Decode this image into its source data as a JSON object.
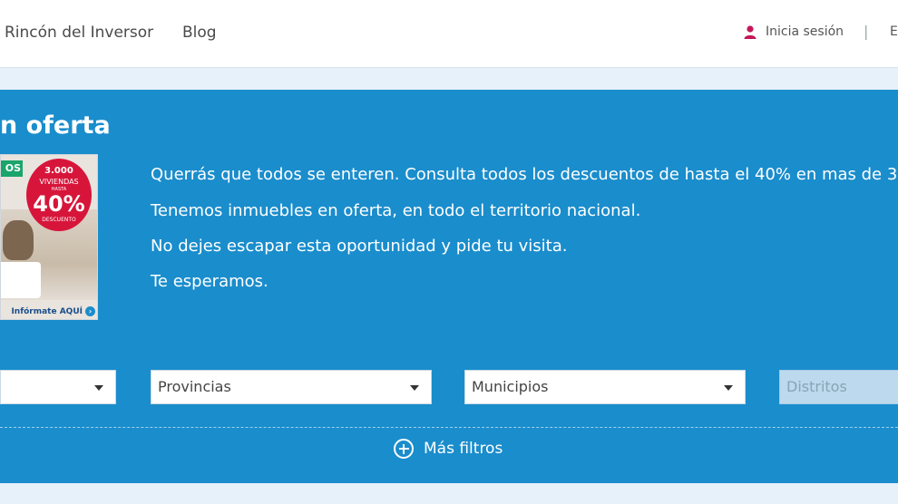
{
  "nav": {
    "links": [
      "Rincón del Inversor",
      "Blog"
    ],
    "login_label": "Inicia sesión",
    "separator": "|",
    "edge_text": "E"
  },
  "panel": {
    "title": "n oferta",
    "promo": {
      "tag": "OS",
      "count": "3.000",
      "viviendas": "VIVIENDAS",
      "hasta": "HASTA",
      "percent": "40%",
      "descuento": "DESCUENTO",
      "cta": "Infórmate AQUÍ"
    },
    "paragraphs": [
      "Querrás que todos se enteren. Consulta todos los descuentos de hasta el 40% en mas de 3",
      "Tenemos inmuebles en oferta, en todo el territorio nacional.",
      "No dejes escapar esta oportunidad y pide tu visita.",
      "Te esperamos."
    ],
    "filters": {
      "first": "",
      "provincias": "Provincias",
      "municipios": "Municipios",
      "distritos": "Distritos"
    },
    "more_filters": "Más filtros"
  },
  "colors": {
    "panel_bg": "#1a8dcc",
    "page_bg": "#e6f1f9",
    "user_icon": "#c2185b",
    "promo_red": "#d7153a"
  }
}
